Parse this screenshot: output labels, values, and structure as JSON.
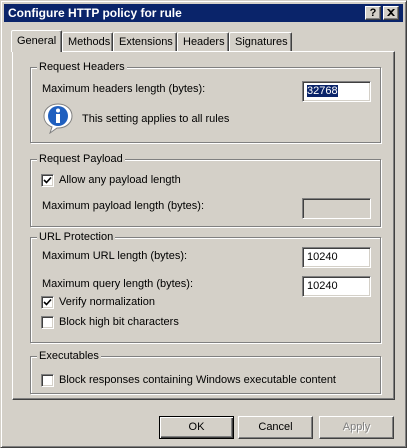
{
  "window": {
    "title": "Configure HTTP policy for rule",
    "help_button": "?",
    "close_button": "X"
  },
  "tabs": [
    {
      "label": "General",
      "active": true
    },
    {
      "label": "Methods",
      "active": false
    },
    {
      "label": "Extensions",
      "active": false
    },
    {
      "label": "Headers",
      "active": false
    },
    {
      "label": "Signatures",
      "active": false
    }
  ],
  "request_headers": {
    "group_label": "Request Headers",
    "max_headers_label": "Maximum headers length (bytes):",
    "max_headers_value": "32768",
    "info_text": "This setting applies to all rules"
  },
  "request_payload": {
    "group_label": "Request Payload",
    "allow_any_label": "Allow any payload length",
    "allow_any_checked": true,
    "max_payload_label": "Maximum payload length (bytes):",
    "max_payload_value": ""
  },
  "url_protection": {
    "group_label": "URL Protection",
    "max_url_label": "Maximum URL length (bytes):",
    "max_url_value": "10240",
    "max_query_label": "Maximum query length (bytes):",
    "max_query_value": "10240",
    "verify_label": "Verify normalization",
    "verify_checked": true,
    "block_high_bit_label": "Block high bit characters",
    "block_high_bit_checked": false
  },
  "executables": {
    "group_label": "Executables",
    "block_exec_label": "Block responses containing Windows executable content",
    "block_exec_checked": false
  },
  "buttons": {
    "ok": "OK",
    "cancel": "Cancel",
    "apply": "Apply"
  },
  "colors": {
    "titlebar": "#0a246a",
    "face": "#d4d0c8",
    "info_icon": "#1f5fbf"
  },
  "icons": {
    "info": "info-icon"
  }
}
